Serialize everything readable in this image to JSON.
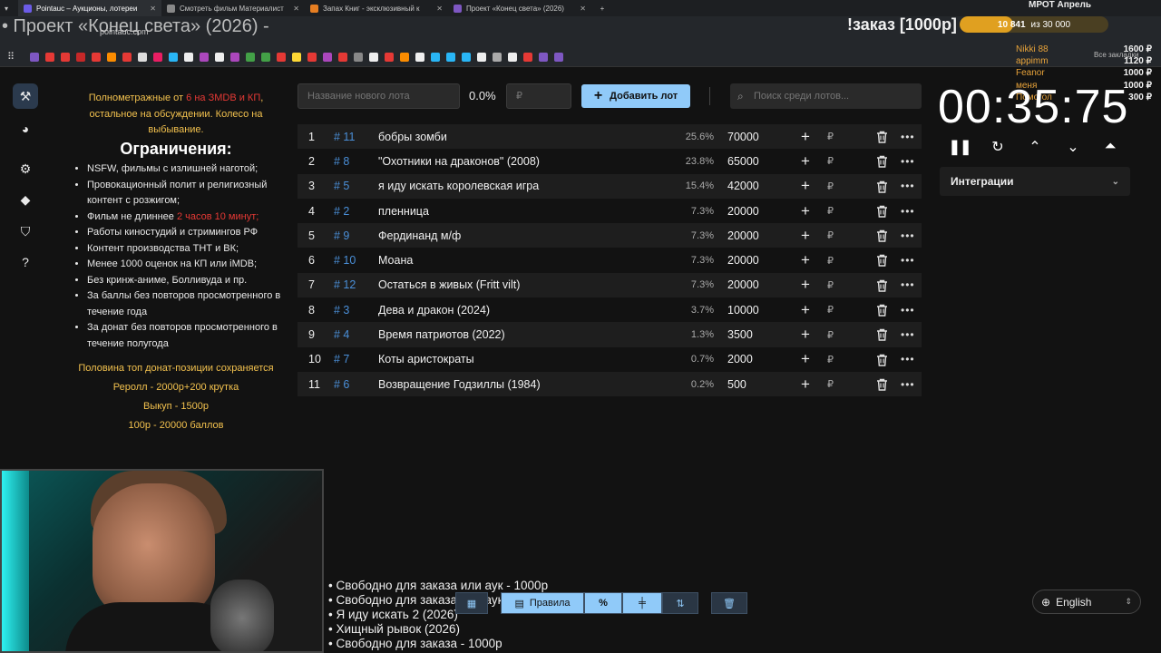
{
  "browser": {
    "tabs": [
      {
        "title": "Pointauc – Аукционы, лотереи",
        "color": "#6c5ce7",
        "active": true
      },
      {
        "title": "Смотреть фильм Материалист",
        "color": "#888888",
        "active": false
      },
      {
        "title": "Запах Книг - эксклюзивный к",
        "color": "#e67e22",
        "active": false
      },
      {
        "title": "Проект «Конец света» (2026)",
        "color": "#7e57c2",
        "active": false
      }
    ],
    "url": "pointauc.com",
    "overlay_title": "• Проект «Конец света» (2026) -",
    "bookmarks_all": "Все закладки"
  },
  "stream": {
    "order_label": "!заказ [1000р]",
    "goal_title": "МРОТ Апрель",
    "goal_current": "10 841",
    "goal_target": "из 30 000",
    "goal_progress": 0.36,
    "donors": [
      {
        "name": "Nikki 88",
        "amount": "1600 ₽"
      },
      {
        "name": "appimm",
        "amount": "1120 ₽"
      },
      {
        "name": "Feanor",
        "amount": "1000 ₽"
      },
      {
        "name": "меня",
        "amount": "1000 ₽"
      },
      {
        "name": "Помогол",
        "amount": "300 ₽"
      }
    ]
  },
  "nav": {
    "items": [
      {
        "name": "auction-icon",
        "glyph": "⚒",
        "active": true
      },
      {
        "name": "wheel-icon",
        "glyph": "◕",
        "active": false
      },
      {
        "name": "gear-icon",
        "glyph": "⚙",
        "active": false
      },
      {
        "name": "layers-icon",
        "glyph": "◆",
        "active": false
      },
      {
        "name": "shield-icon",
        "glyph": "⛉",
        "active": false
      },
      {
        "name": "help-icon",
        "glyph": "?",
        "active": false
      }
    ]
  },
  "rules": {
    "intro_a": "Полнометражные от ",
    "intro_red": "6 на ЗМDB и КП",
    "intro_b": ", остальное на обсуждении. Колесо на выбывание.",
    "heading": "Ограничения:",
    "items": [
      "NSFW, фильмы с излишней наготой;",
      "Провокационный полит и религиозный контент с розжигом;",
      "Фильм не длиннее ",
      "Работы киностудий и стримингов РФ",
      "Контент производства ТНТ и ВК;",
      "Менее 1000 оценок на КП или iMDB;",
      "Без кринж-аниме, Болливуда и пр.",
      "За баллы без повторов просмотренного в течение года",
      "За донат без повторов просмотренного в течение полугода"
    ],
    "length_red": "2 часов 10 минут;",
    "footer": [
      "Половина топ донат-позиции сохраняется",
      "Реролл - 2000р+200 крутка",
      "Выкуп - 1500р",
      "100р - 20000 баллов"
    ]
  },
  "form": {
    "name_placeholder": "Название нового лота",
    "percent": "0.0%",
    "amount_placeholder": "₽",
    "add_label": "Добавить лот",
    "search_placeholder": "Поиск среди лотов..."
  },
  "lots": [
    {
      "rank": "1",
      "id": "# 11",
      "name": "бобры зомби",
      "pct": "25.6%",
      "amount": "70000"
    },
    {
      "rank": "2",
      "id": "# 8",
      "name": "\"Охотники на драконов\" (2008)",
      "pct": "23.8%",
      "amount": "65000"
    },
    {
      "rank": "3",
      "id": "# 5",
      "name": "я иду искать королевская игра",
      "pct": "15.4%",
      "amount": "42000"
    },
    {
      "rank": "4",
      "id": "# 2",
      "name": "пленница",
      "pct": "7.3%",
      "amount": "20000"
    },
    {
      "rank": "5",
      "id": "# 9",
      "name": "Фердинанд м/ф",
      "pct": "7.3%",
      "amount": "20000"
    },
    {
      "rank": "6",
      "id": "# 10",
      "name": "Моана",
      "pct": "7.3%",
      "amount": "20000"
    },
    {
      "rank": "7",
      "id": "# 12",
      "name": "Остаться в живых (Fritt vilt)",
      "pct": "7.3%",
      "amount": "20000"
    },
    {
      "rank": "8",
      "id": "# 3",
      "name": "Дева и дракон (2024)",
      "pct": "3.7%",
      "amount": "10000"
    },
    {
      "rank": "9",
      "id": "# 4",
      "name": "Время патриотов (2022)",
      "pct": "1.3%",
      "amount": "3500"
    },
    {
      "rank": "10",
      "id": "# 7",
      "name": "Коты аристократы",
      "pct": "0.7%",
      "amount": "2000"
    },
    {
      "rank": "11",
      "id": "# 6",
      "name": "Возвращение Годзиллы (1984)",
      "pct": "0.2%",
      "amount": "500"
    }
  ],
  "lot_currency": "₽",
  "timer": {
    "display": "00:35:75",
    "integrations_label": "Интеграции"
  },
  "queue": [
    "• Свободно для заказа или аук - 1000р",
    "• Свободно для заказа или аук - 1000р",
    "• Я иду искать 2 (2026)",
    "• Хищный рывок (2026)",
    "• Свободно для заказа - 1000р"
  ],
  "toolbar": {
    "rules_label": "Правила",
    "percent_label": "%"
  },
  "language": "English"
}
